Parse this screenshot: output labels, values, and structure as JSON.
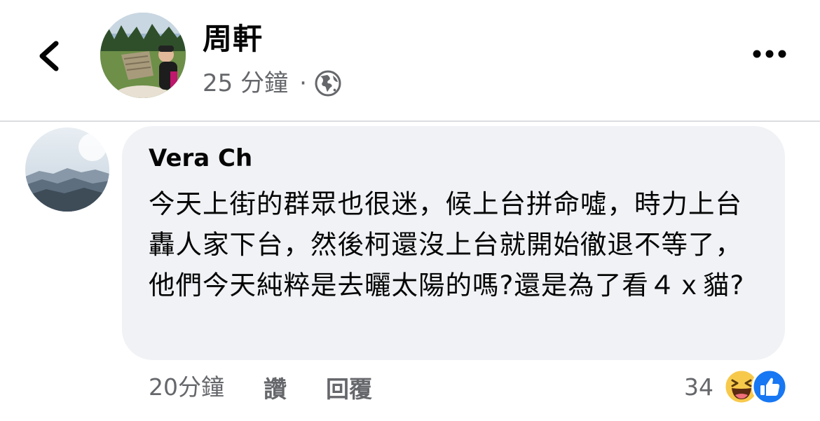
{
  "post": {
    "author_name": "周軒",
    "time": "25 分鐘",
    "separator": "·",
    "audience_icon": "globe-icon"
  },
  "comment": {
    "author_name": "Vera Ch",
    "text": "今天上街的群眾也很迷，候上台拼命噓，時力上台轟人家下台，然後柯還沒上台就開始徹退不等了，他們今天純粹是去曬太陽的嗎?還是為了看４ｘ貓?",
    "time": "20分鐘",
    "like_label": "讚",
    "reply_label": "回覆",
    "reaction_count": "34",
    "reaction_icons": [
      "haha-icon",
      "like-icon"
    ]
  },
  "icons": {
    "back": "chevron-left-icon",
    "more": "more-dots-icon"
  },
  "colors": {
    "text_primary": "#050505",
    "text_secondary": "#65676b",
    "bubble_bg": "#f0f2f5",
    "like_blue": "#1877f2",
    "haha_yellow": "#f7c94b"
  }
}
